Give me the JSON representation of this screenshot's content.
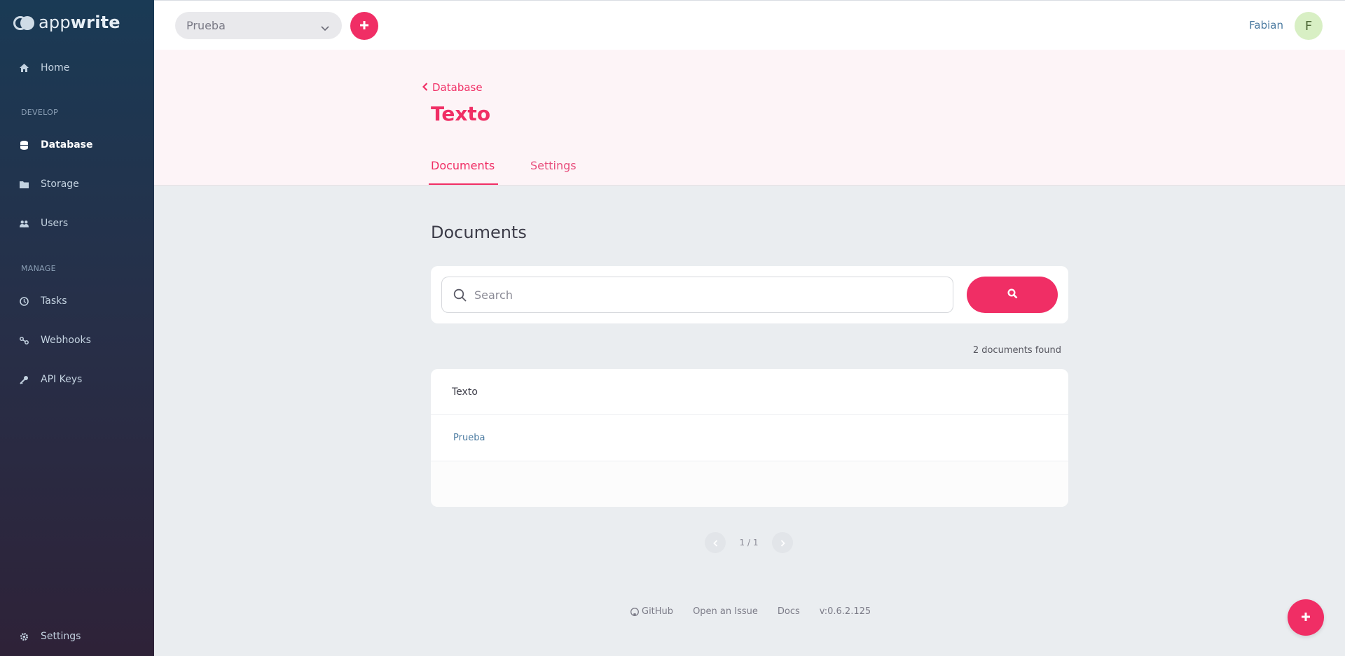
{
  "app": {
    "logo_text_light": "app",
    "logo_text_bold": "write"
  },
  "sidebar": {
    "home": "Home",
    "develop_label": "DEVELOP",
    "develop_items": [
      {
        "label": "Database",
        "icon": "database-icon"
      },
      {
        "label": "Storage",
        "icon": "folder-icon"
      },
      {
        "label": "Users",
        "icon": "users-icon"
      }
    ],
    "manage_label": "MANAGE",
    "manage_items": [
      {
        "label": "Tasks",
        "icon": "clock-icon"
      },
      {
        "label": "Webhooks",
        "icon": "webhook-icon"
      },
      {
        "label": "API Keys",
        "icon": "key-icon"
      }
    ],
    "settings": "Settings"
  },
  "topbar": {
    "project": "Prueba",
    "user_name": "Fabian",
    "avatar_initial": "F"
  },
  "header": {
    "back_label": "Database",
    "title": "Texto",
    "tabs": [
      {
        "label": "Documents",
        "active": true
      },
      {
        "label": "Settings",
        "active": false
      }
    ]
  },
  "main": {
    "section_title": "Documents",
    "search_placeholder": "Search",
    "found_text": "2 documents found",
    "table": {
      "column": "Texto",
      "rows": [
        "Prueba"
      ]
    },
    "pagination": "1 / 1"
  },
  "footer": {
    "github": "GitHub",
    "issue": "Open an Issue",
    "docs": "Docs",
    "version": "v:0.6.2.125"
  },
  "colors": {
    "accent": "#f02e65",
    "link": "#4a7aa0"
  }
}
